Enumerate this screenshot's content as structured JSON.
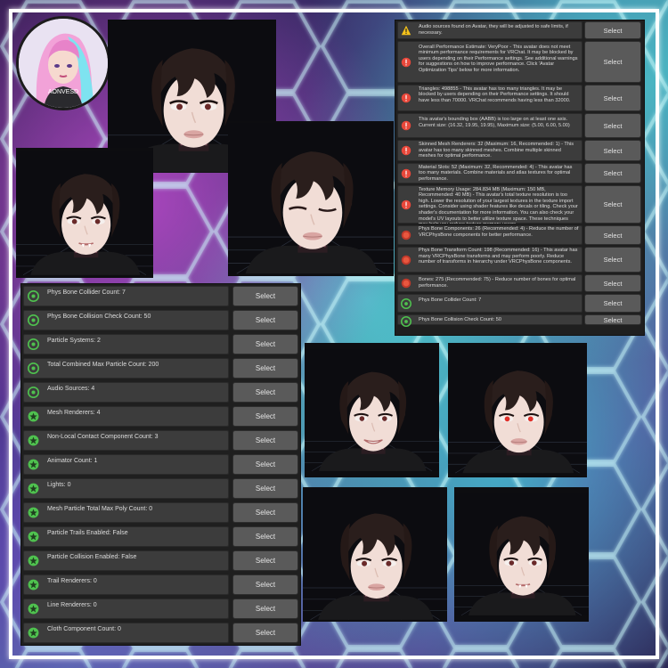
{
  "colors": {
    "accent_green": "#4fc24f",
    "warning_yellow": "#f4c21b",
    "error_red": "#e8473a",
    "panel_row": "#3c3c3c",
    "button": "#5a5a5a"
  },
  "logo": {
    "text": "AONVESD",
    "icon": "anime-girl-avatar-logo"
  },
  "top_panel": {
    "rows": [
      {
        "icon": "warning-icon",
        "text": "Audio sources found on Avatar, they will be adjusted to safe limits, if necessary.",
        "button": "Select"
      },
      {
        "icon": "error-icon",
        "text": "Overall Performance Estimate: VeryPoor - This avatar does not meet minimum performance requirements for VRChat. It may be blocked by users depending on their Performance settings. See additional warnings for suggestions on how to improve performance. Click 'Avatar Optimization Tips' below for more information.",
        "button": "Select"
      },
      {
        "icon": "error-icon",
        "text": "Triangles: 498855 - This avatar has too many triangles. It may be blocked by users depending on their Performance settings. It should have less than 70000. VRChat recommends having less than 32000.",
        "button": "Select"
      },
      {
        "icon": "error-icon",
        "text": "This avatar's bounding box (AABB) is too large on at least one axis. Current size: (16.32, 19.95, 19.95), Maximum size: (5.00, 6.00, 5.00)",
        "button": "Select"
      },
      {
        "icon": "error-icon",
        "text": "Skinned Mesh Renderers: 32 (Maximum: 16, Recommended: 1) - This avatar has too many skinned meshes. Combine multiple skinned meshes for optimal performance.",
        "button": "Select"
      },
      {
        "icon": "error-icon",
        "text": "Material Slots: 52 (Maximum: 32, Recommended: 4) - This avatar has too many materials. Combine materials and atlas textures for optimal performance.",
        "button": "Select"
      },
      {
        "icon": "error-icon",
        "text": "Texture Memory Usage: 284.834 MB (Maximum: 150 MB, Recommended: 40 MB) - This avatar's total texture resolution is too high. Lower the resolution of your largest textures in the texture import settings. Consider using shader features like decals or tiling. Check your shader's documentation for more information. You can also check your model's UV layouts to better utilize texture space. These techniques may help you reduce texture memory usage.",
        "button": "Select"
      },
      {
        "icon": "poor-icon",
        "text": "Phys Bone Components: 26 (Recommended: 4) - Reduce the number of VRCPhysBone components for better performance.",
        "button": "Select"
      },
      {
        "icon": "poor-icon",
        "text": "Phys Bone Transform Count: 198 (Recommended: 16) - This avatar has many VRCPhysBone transforms and may perform poorly. Reduce number of transforms in hierarchy under VRCPhysBone components.",
        "button": "Select"
      },
      {
        "icon": "poor-icon",
        "text": "Bones: 275 (Recommended: 75) - Reduce number of bones for optimal performance.",
        "button": "Select"
      },
      {
        "icon": "good-icon",
        "text": "Phys Bone Collider Count: 7",
        "button": "Select"
      },
      {
        "icon": "good-icon",
        "text": "Phys Bone Collision Check Count: 50",
        "button": "Select"
      }
    ]
  },
  "left_panel": {
    "rows": [
      {
        "icon": "good-icon",
        "text": "Phys Bone Collider Count: 7",
        "button": "Select"
      },
      {
        "icon": "good-icon",
        "text": "Phys Bone Collision Check Count: 50",
        "button": "Select"
      },
      {
        "icon": "good-icon",
        "text": "Particle Systems: 2",
        "button": "Select"
      },
      {
        "icon": "good-icon",
        "text": "Total Combined Max Particle Count: 200",
        "button": "Select"
      },
      {
        "icon": "good-icon",
        "text": "Audio Sources: 4",
        "button": "Select"
      },
      {
        "icon": "excellent-icon",
        "text": "Mesh Renderers: 4",
        "button": "Select"
      },
      {
        "icon": "excellent-icon",
        "text": "Non-Local Contact Component Count: 3",
        "button": "Select"
      },
      {
        "icon": "excellent-icon",
        "text": "Animator Count: 1",
        "button": "Select"
      },
      {
        "icon": "excellent-icon",
        "text": "Lights: 0",
        "button": "Select"
      },
      {
        "icon": "excellent-icon",
        "text": "Mesh Particle Total Max Poly Count: 0",
        "button": "Select"
      },
      {
        "icon": "excellent-icon",
        "text": "Particle Trails Enabled: False",
        "button": "Select"
      },
      {
        "icon": "excellent-icon",
        "text": "Particle Collision Enabled: False",
        "button": "Select"
      },
      {
        "icon": "excellent-icon",
        "text": "Trail Renderers: 0",
        "button": "Select"
      },
      {
        "icon": "excellent-icon",
        "text": "Line Renderers: 0",
        "button": "Select"
      },
      {
        "icon": "excellent-icon",
        "text": "Cloth Component Count: 0",
        "button": "Select"
      }
    ]
  },
  "photos": [
    {
      "name": "avatar-photo-front",
      "expression": "neutral"
    },
    {
      "name": "avatar-photo-closeup",
      "expression": "fangs"
    },
    {
      "name": "avatar-photo-wink",
      "expression": "wink"
    },
    {
      "name": "avatar-photo-smile",
      "expression": "smile"
    },
    {
      "name": "avatar-photo-red-eyes",
      "expression": "red-eyes"
    },
    {
      "name": "avatar-photo-neutral-red",
      "expression": "neutral"
    },
    {
      "name": "avatar-photo-fangs-side",
      "expression": "fangs"
    }
  ]
}
